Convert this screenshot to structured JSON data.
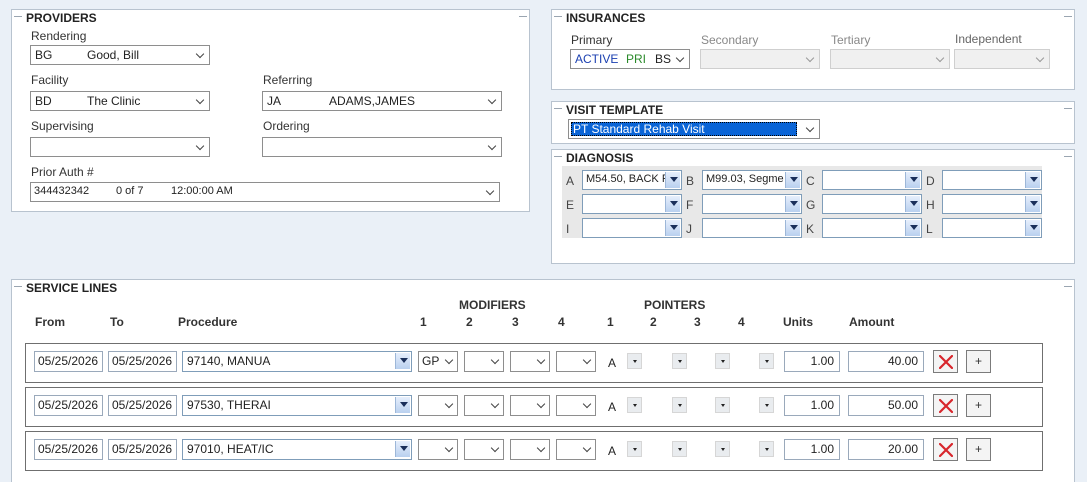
{
  "providers": {
    "title": "PROVIDERS",
    "rendering": {
      "label": "Rendering",
      "code": "BG",
      "name": "Good, Bill"
    },
    "facility": {
      "label": "Facility",
      "code": "BD",
      "name": "The Clinic"
    },
    "referring": {
      "label": "Referring",
      "code": "JA",
      "name": "ADAMS,JAMES"
    },
    "supervising": {
      "label": "Supervising",
      "value": ""
    },
    "ordering": {
      "label": "Ordering",
      "value": ""
    },
    "prior_auth": {
      "label": "Prior Auth #",
      "number": "344432342",
      "count": "0 of 7",
      "time": "12:00:00 AM"
    }
  },
  "insurances": {
    "title": "INSURANCES",
    "primary": {
      "label": "Primary",
      "status": "ACTIVE",
      "type": "PRI",
      "code": "BS",
      "status_color": "#1a3fb0",
      "type_color": "#2a8a2a"
    },
    "secondary": {
      "label": "Secondary"
    },
    "tertiary": {
      "label": "Tertiary"
    },
    "independent": {
      "label": "Independent"
    }
  },
  "visit_template": {
    "title": "VISIT TEMPLATE",
    "selected": "PT Standard Rehab Visit",
    "highlight_color": "#0a64d6"
  },
  "diagnosis": {
    "title": "DIAGNOSIS",
    "slots": [
      {
        "letter": "A",
        "value": "M54.50, BACK F"
      },
      {
        "letter": "B",
        "value": "M99.03, Segme"
      },
      {
        "letter": "C",
        "value": ""
      },
      {
        "letter": "D",
        "value": ""
      },
      {
        "letter": "E",
        "value": ""
      },
      {
        "letter": "F",
        "value": ""
      },
      {
        "letter": "G",
        "value": ""
      },
      {
        "letter": "H",
        "value": ""
      },
      {
        "letter": "I",
        "value": ""
      },
      {
        "letter": "J",
        "value": ""
      },
      {
        "letter": "K",
        "value": ""
      },
      {
        "letter": "L",
        "value": ""
      }
    ]
  },
  "service_lines": {
    "title": "SERVICE LINES",
    "headers": {
      "from": "From",
      "to": "To",
      "procedure": "Procedure",
      "modifiers": "MODIFIERS",
      "pointers": "POINTERS",
      "m1": "1",
      "m2": "2",
      "m3": "3",
      "m4": "4",
      "p1": "1",
      "p2": "2",
      "p3": "3",
      "p4": "4",
      "units": "Units",
      "amount": "Amount"
    },
    "plus_label": "+",
    "lines": [
      {
        "from": "05/25/2026",
        "to": "05/25/2026",
        "procedure": "97140, MANUA",
        "mod1": "GP",
        "mod2": "",
        "mod3": "",
        "mod4": "",
        "pointer1": "A",
        "units": "1.00",
        "amount": "40.00"
      },
      {
        "from": "05/25/2026",
        "to": "05/25/2026",
        "procedure": "97530, THERAI",
        "mod1": "",
        "mod2": "",
        "mod3": "",
        "mod4": "",
        "pointer1": "A",
        "units": "1.00",
        "amount": "50.00"
      },
      {
        "from": "05/25/2026",
        "to": "05/25/2026",
        "procedure": "97010, HEAT/IC",
        "mod1": "",
        "mod2": "",
        "mod3": "",
        "mod4": "",
        "pointer1": "A",
        "units": "1.00",
        "amount": "20.00"
      }
    ]
  },
  "icons": {
    "delete": "delete-x-icon",
    "dropdown": "chevron-down-icon"
  }
}
